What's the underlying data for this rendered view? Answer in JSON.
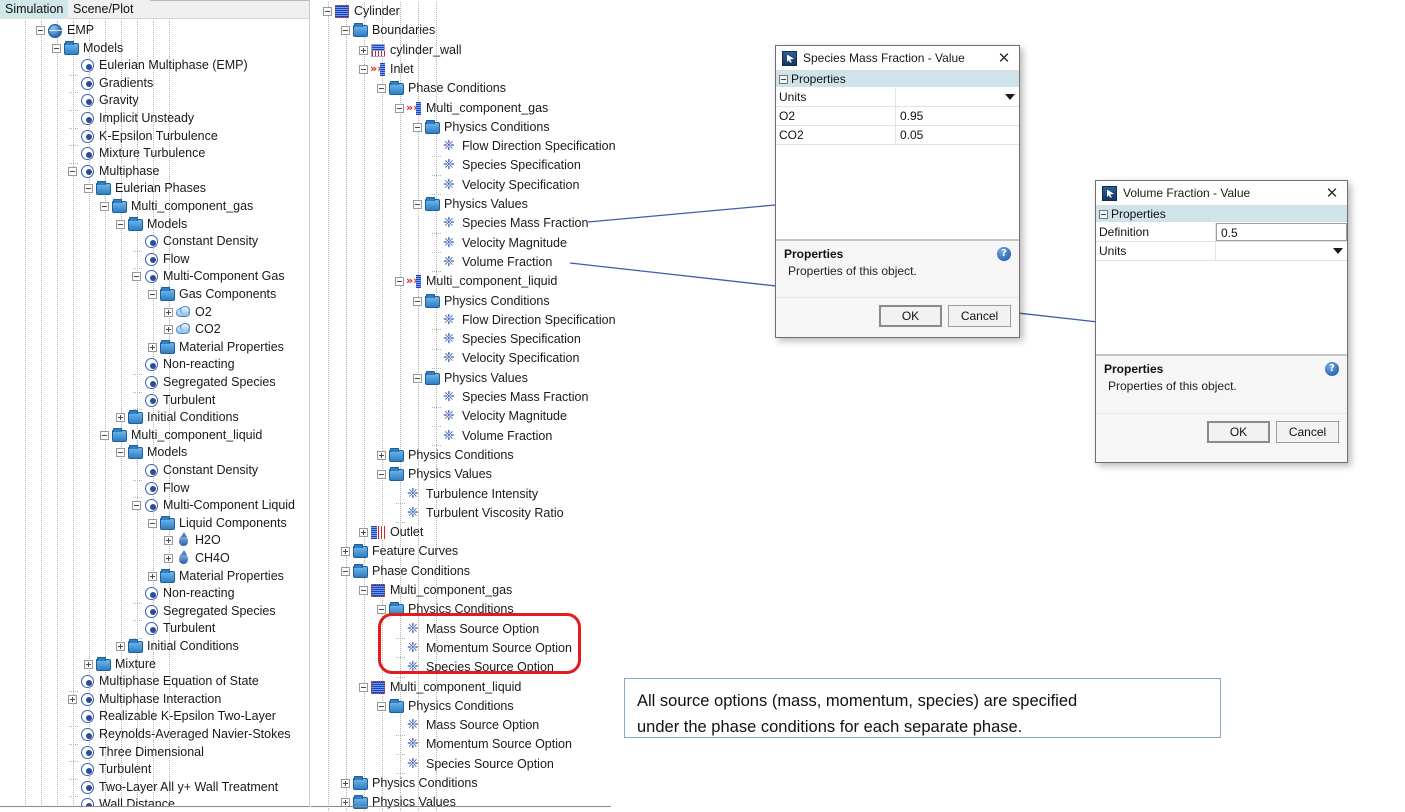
{
  "left_panel": {
    "tabs": [
      {
        "label": "Simulation",
        "active": true
      },
      {
        "label": "Scene/Plot",
        "active": false
      }
    ],
    "tree": [
      {
        "label": "EMP",
        "depth": 1,
        "icon": "globe-icon",
        "toggle": "minus"
      },
      {
        "label": "Models",
        "depth": 2,
        "icon": "folder-icon",
        "toggle": "minus"
      },
      {
        "label": "Eulerian Multiphase (EMP)",
        "depth": 3,
        "icon": "node-icon",
        "toggle": "none"
      },
      {
        "label": "Gradients",
        "depth": 3,
        "icon": "node-icon",
        "toggle": "none"
      },
      {
        "label": "Gravity",
        "depth": 3,
        "icon": "node-icon",
        "toggle": "none"
      },
      {
        "label": "Implicit Unsteady",
        "depth": 3,
        "icon": "node-icon",
        "toggle": "none"
      },
      {
        "label": "K-Epsilon Turbulence",
        "depth": 3,
        "icon": "node-icon",
        "toggle": "none"
      },
      {
        "label": "Mixture Turbulence",
        "depth": 3,
        "icon": "node-icon",
        "toggle": "none"
      },
      {
        "label": "Multiphase",
        "depth": 3,
        "icon": "node-icon",
        "toggle": "minus"
      },
      {
        "label": "Eulerian Phases",
        "depth": 4,
        "icon": "folder-icon",
        "toggle": "minus"
      },
      {
        "label": "Multi_component_gas",
        "depth": 5,
        "icon": "folder-icon",
        "toggle": "minus"
      },
      {
        "label": "Models",
        "depth": 6,
        "icon": "folder-icon",
        "toggle": "minus"
      },
      {
        "label": "Constant Density",
        "depth": 7,
        "icon": "node-icon",
        "toggle": "none"
      },
      {
        "label": "Flow",
        "depth": 7,
        "icon": "node-icon",
        "toggle": "none"
      },
      {
        "label": "Multi-Component Gas",
        "depth": 7,
        "icon": "node-icon",
        "toggle": "minus"
      },
      {
        "label": "Gas Components",
        "depth": 8,
        "icon": "folder-icon",
        "toggle": "minus"
      },
      {
        "label": "O2",
        "depth": 9,
        "icon": "cloud-icon",
        "toggle": "plus"
      },
      {
        "label": "CO2",
        "depth": 9,
        "icon": "cloud-icon",
        "toggle": "plus"
      },
      {
        "label": "Material Properties",
        "depth": 8,
        "icon": "folder-icon",
        "toggle": "plus"
      },
      {
        "label": "Non-reacting",
        "depth": 7,
        "icon": "node-icon",
        "toggle": "none"
      },
      {
        "label": "Segregated Species",
        "depth": 7,
        "icon": "node-icon",
        "toggle": "none"
      },
      {
        "label": "Turbulent",
        "depth": 7,
        "icon": "node-icon",
        "toggle": "none"
      },
      {
        "label": "Initial Conditions",
        "depth": 6,
        "icon": "folder-icon",
        "toggle": "plus"
      },
      {
        "label": "Multi_component_liquid",
        "depth": 5,
        "icon": "folder-icon",
        "toggle": "minus"
      },
      {
        "label": "Models",
        "depth": 6,
        "icon": "folder-icon",
        "toggle": "minus"
      },
      {
        "label": "Constant Density",
        "depth": 7,
        "icon": "node-icon",
        "toggle": "none"
      },
      {
        "label": "Flow",
        "depth": 7,
        "icon": "node-icon",
        "toggle": "none"
      },
      {
        "label": "Multi-Component Liquid",
        "depth": 7,
        "icon": "node-icon",
        "toggle": "minus"
      },
      {
        "label": "Liquid Components",
        "depth": 8,
        "icon": "folder-icon",
        "toggle": "minus"
      },
      {
        "label": "H2O",
        "depth": 9,
        "icon": "droplet-icon",
        "toggle": "plus"
      },
      {
        "label": "CH4O",
        "depth": 9,
        "icon": "droplet-icon",
        "toggle": "plus"
      },
      {
        "label": "Material Properties",
        "depth": 8,
        "icon": "folder-icon",
        "toggle": "plus"
      },
      {
        "label": "Non-reacting",
        "depth": 7,
        "icon": "node-icon",
        "toggle": "none"
      },
      {
        "label": "Segregated Species",
        "depth": 7,
        "icon": "node-icon",
        "toggle": "none"
      },
      {
        "label": "Turbulent",
        "depth": 7,
        "icon": "node-icon",
        "toggle": "none"
      },
      {
        "label": "Initial Conditions",
        "depth": 6,
        "icon": "folder-icon",
        "toggle": "plus"
      },
      {
        "label": "Mixture",
        "depth": 4,
        "icon": "folder-icon",
        "toggle": "plus"
      },
      {
        "label": "Multiphase Equation of State",
        "depth": 3,
        "icon": "node-icon",
        "toggle": "none"
      },
      {
        "label": "Multiphase Interaction",
        "depth": 3,
        "icon": "node-icon",
        "toggle": "plus"
      },
      {
        "label": "Realizable K-Epsilon Two-Layer",
        "depth": 3,
        "icon": "node-icon",
        "toggle": "none"
      },
      {
        "label": "Reynolds-Averaged Navier-Stokes",
        "depth": 3,
        "icon": "node-icon",
        "toggle": "none"
      },
      {
        "label": "Three Dimensional",
        "depth": 3,
        "icon": "node-icon",
        "toggle": "none"
      },
      {
        "label": "Turbulent",
        "depth": 3,
        "icon": "node-icon",
        "toggle": "none"
      },
      {
        "label": "Two-Layer All y+ Wall Treatment",
        "depth": 3,
        "icon": "node-icon",
        "toggle": "none"
      },
      {
        "label": "Wall Distance",
        "depth": 3,
        "icon": "node-icon",
        "toggle": "none"
      }
    ]
  },
  "center_panel": {
    "tree": [
      {
        "label": "Cylinder",
        "depth": 0,
        "icon": "region-icon",
        "toggle": "minus"
      },
      {
        "label": "Boundaries",
        "depth": 1,
        "icon": "folder-icon",
        "toggle": "minus"
      },
      {
        "label": "cylinder_wall",
        "depth": 2,
        "icon": "wall-boundary-icon",
        "toggle": "plus"
      },
      {
        "label": "Inlet",
        "depth": 2,
        "icon": "inlet-boundary-icon",
        "toggle": "minus"
      },
      {
        "label": "Phase Conditions",
        "depth": 3,
        "icon": "folder-icon",
        "toggle": "minus"
      },
      {
        "label": "Multi_component_gas",
        "depth": 4,
        "icon": "inlet-boundary-icon",
        "toggle": "minus"
      },
      {
        "label": "Physics Conditions",
        "depth": 5,
        "icon": "folder-icon",
        "toggle": "minus"
      },
      {
        "label": "Flow Direction Specification",
        "depth": 6,
        "icon": "physics-icon",
        "toggle": "none"
      },
      {
        "label": "Species Specification",
        "depth": 6,
        "icon": "physics-icon",
        "toggle": "none"
      },
      {
        "label": "Velocity Specification",
        "depth": 6,
        "icon": "physics-icon",
        "toggle": "none"
      },
      {
        "label": "Physics Values",
        "depth": 5,
        "icon": "folder-icon",
        "toggle": "minus"
      },
      {
        "label": "Species Mass Fraction",
        "depth": 6,
        "icon": "physics-icon",
        "toggle": "none"
      },
      {
        "label": "Velocity Magnitude",
        "depth": 6,
        "icon": "physics-icon",
        "toggle": "none"
      },
      {
        "label": "Volume Fraction",
        "depth": 6,
        "icon": "physics-icon",
        "toggle": "none"
      },
      {
        "label": "Multi_component_liquid",
        "depth": 4,
        "icon": "inlet-boundary-icon",
        "toggle": "minus"
      },
      {
        "label": "Physics Conditions",
        "depth": 5,
        "icon": "folder-icon",
        "toggle": "minus"
      },
      {
        "label": "Flow Direction Specification",
        "depth": 6,
        "icon": "physics-icon",
        "toggle": "none"
      },
      {
        "label": "Species Specification",
        "depth": 6,
        "icon": "physics-icon",
        "toggle": "none"
      },
      {
        "label": "Velocity Specification",
        "depth": 6,
        "icon": "physics-icon",
        "toggle": "none"
      },
      {
        "label": "Physics Values",
        "depth": 5,
        "icon": "folder-icon",
        "toggle": "minus"
      },
      {
        "label": "Species Mass Fraction",
        "depth": 6,
        "icon": "physics-icon",
        "toggle": "none"
      },
      {
        "label": "Velocity Magnitude",
        "depth": 6,
        "icon": "physics-icon",
        "toggle": "none"
      },
      {
        "label": "Volume Fraction",
        "depth": 6,
        "icon": "physics-icon",
        "toggle": "none"
      },
      {
        "label": "Physics Conditions",
        "depth": 3,
        "icon": "folder-icon",
        "toggle": "plus"
      },
      {
        "label": "Physics Values",
        "depth": 3,
        "icon": "folder-icon",
        "toggle": "minus"
      },
      {
        "label": "Turbulence Intensity",
        "depth": 4,
        "icon": "physics-icon",
        "toggle": "none"
      },
      {
        "label": "Turbulent Viscosity Ratio",
        "depth": 4,
        "icon": "physics-icon",
        "toggle": "none"
      },
      {
        "label": "Outlet",
        "depth": 2,
        "icon": "outlet-boundary-icon",
        "toggle": "plus"
      },
      {
        "label": "Feature Curves",
        "depth": 1,
        "icon": "folder-icon",
        "toggle": "plus"
      },
      {
        "label": "Phase Conditions",
        "depth": 1,
        "icon": "folder-icon",
        "toggle": "minus"
      },
      {
        "label": "Multi_component_gas",
        "depth": 2,
        "icon": "region-icon",
        "toggle": "minus"
      },
      {
        "label": "Physics Conditions",
        "depth": 3,
        "icon": "folder-icon",
        "toggle": "minus"
      },
      {
        "label": "Mass Source Option",
        "depth": 4,
        "icon": "physics-icon",
        "toggle": "none"
      },
      {
        "label": "Momentum Source Option",
        "depth": 4,
        "icon": "physics-icon",
        "toggle": "none"
      },
      {
        "label": "Species Source Option",
        "depth": 4,
        "icon": "physics-icon",
        "toggle": "none"
      },
      {
        "label": "Multi_component_liquid",
        "depth": 2,
        "icon": "region-icon",
        "toggle": "minus"
      },
      {
        "label": "Physics Conditions",
        "depth": 3,
        "icon": "folder-icon",
        "toggle": "minus"
      },
      {
        "label": "Mass Source Option",
        "depth": 4,
        "icon": "physics-icon",
        "toggle": "none"
      },
      {
        "label": "Momentum Source Option",
        "depth": 4,
        "icon": "physics-icon",
        "toggle": "none"
      },
      {
        "label": "Species Source Option",
        "depth": 4,
        "icon": "physics-icon",
        "toggle": "none"
      },
      {
        "label": "Physics Conditions",
        "depth": 1,
        "icon": "folder-icon",
        "toggle": "plus"
      },
      {
        "label": "Physics Values",
        "depth": 1,
        "icon": "folder-icon",
        "toggle": "plus"
      }
    ]
  },
  "dialog_species": {
    "title": "Species Mass Fraction - Value",
    "close_label": "✕",
    "properties_header": "Properties",
    "rows": [
      {
        "key": "Units",
        "value": "",
        "control": "dropdown"
      },
      {
        "key": "O2",
        "value": "0.95",
        "control": "text"
      },
      {
        "key": "CO2",
        "value": "0.05",
        "control": "text"
      }
    ],
    "desc_title": "Properties",
    "desc_body": "Properties of this object.",
    "help_glyph": "?",
    "ok_label": "OK",
    "cancel_label": "Cancel"
  },
  "dialog_volume": {
    "title": "Volume Fraction - Value",
    "close_label": "✕",
    "properties_header": "Properties",
    "rows": [
      {
        "key": "Definition",
        "value": "0.5",
        "control": "ellipsis"
      },
      {
        "key": "Units",
        "value": "",
        "control": "dropdown"
      }
    ],
    "desc_title": "Properties",
    "desc_body": "Properties of this object.",
    "help_glyph": "?",
    "ok_label": "OK",
    "cancel_label": "Cancel"
  },
  "callout": {
    "line1": "All source options (mass, momentum, species) are specified",
    "line2": "under the phase conditions for each separate phase."
  },
  "colors": {
    "highlight_red": "#e21b1b",
    "callout_border": "#8ca8cc",
    "connector_blue": "#3a5fa8",
    "active_tab_bg": "#cfe7e7",
    "prop_header_bg": "#cfe4ea"
  }
}
